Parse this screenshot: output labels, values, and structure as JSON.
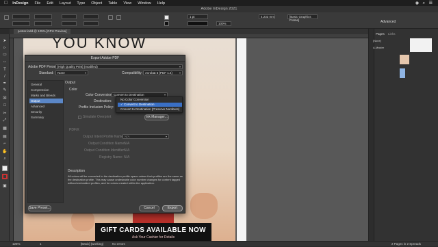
{
  "menubar": {
    "app": "InDesign",
    "items": [
      "File",
      "Edit",
      "Layout",
      "Type",
      "Object",
      "Table",
      "View",
      "Window",
      "Help"
    ]
  },
  "window": {
    "title": "Adobe InDesign 2021"
  },
  "controlbar": {
    "stroke_weight": "1 pt",
    "zoom": "100%",
    "size_value": "4.233 mm",
    "frame_style": "[Basic Graphics Frame]",
    "workspace": "Advanced"
  },
  "document": {
    "tab": "poster.indd @ 125% [GPU Preview]",
    "headline": "YOU KNOW",
    "banner": "GIFT CARDS AVAILABLE NOW",
    "banner_sub": "Ask Your Cashier for Details"
  },
  "statusbar": {
    "zoom": "125%",
    "page": "1",
    "style": "[Basic] (working)",
    "preflight": "No errors",
    "pages_summary": "2 Pages in 2 Spreads"
  },
  "panels": {
    "tabs": [
      "Pages",
      "Links"
    ],
    "none_label": "[None]",
    "master_label": "A-Master"
  },
  "dialog": {
    "title": "Export Adobe PDF",
    "preset_label": "Adobe PDF Preset:",
    "preset_value": "[High Quality Print] (modified)",
    "standard_label": "Standard:",
    "standard_value": "None",
    "compat_label": "Compatibility:",
    "compat_value": "Acrobat 5 (PDF 1.4)",
    "nav": [
      "General",
      "Compression",
      "Marks and Bleeds",
      "Output",
      "Advanced",
      "Security",
      "Summary"
    ],
    "nav_active_index": 3,
    "section_title": "Output",
    "group_color": "Color",
    "color_conv_label": "Color Conversion:",
    "color_conv_value": "Convert to Destination",
    "destination_label": "Destination:",
    "inclusion_label": "Profile Inclusion Policy:",
    "simulate_label": "Simulate Overprint",
    "ink_manager": "Ink Manager...",
    "popup_options": [
      "No Color Conversion",
      "Convert to Destination",
      "Convert to Destination (Preserve Numbers)"
    ],
    "popup_selected_index": 1,
    "group_pdfx": "PDF/X",
    "output_intent_label": "Output Intent Profile Name:",
    "output_intent_value": "N/A",
    "condition_name_label": "Output Condition Name:",
    "condition_name_value": "N/A",
    "condition_id_label": "Output Condition Identifier:",
    "condition_id_value": "N/A",
    "registry_label": "Registry Name:",
    "registry_value": "N/A",
    "description_title": "Description",
    "description_text": "All colors will be converted to the destination profile space unless their profiles are the same as the destination profile. This may cause undesirable color number changes for content tagged without embedded profiles, and for colors created within the application.",
    "save_preset": "Save Preset...",
    "cancel": "Cancel",
    "export": "Export"
  }
}
